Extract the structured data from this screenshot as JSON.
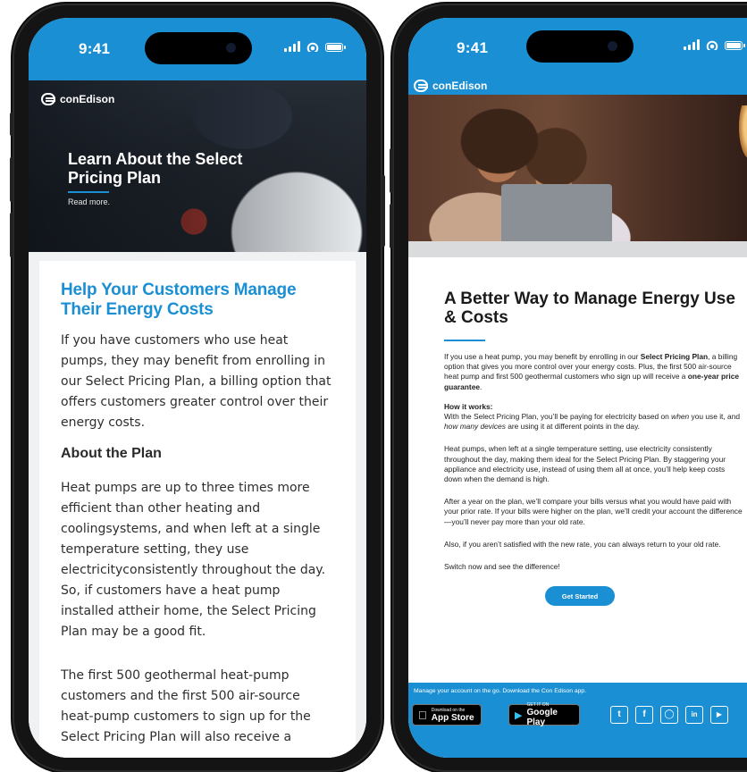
{
  "colors": {
    "brand_blue": "#1b8fd3",
    "dark_bg": "#141414",
    "text": "#2a2a2a"
  },
  "status_bar": {
    "time": "9:41"
  },
  "brand": {
    "name": "conEdison"
  },
  "left": {
    "hero": {
      "title": "Learn About the Select Pricing Plan",
      "link": "Read more."
    },
    "heading": "Help Your Customers Manage Their Energy Costs",
    "intro": "If you have customers who use heat pumps, they may benefit from enrolling in our Select Pricing Plan, a billing option that offers customers greater control over their energy costs.",
    "subheading": "About the Plan",
    "paragraph_1": "Heat pumps are up to three times more efficient than other heating and coolingsystems, and when left at a single temperature setting, they use electricityconsistently throughout the day. So, if customers have a heat pump installed attheir home, the Select Pricing Plan may be a good fit.",
    "paragraph_2": "The first 500 geothermal heat-pump customers and the first 500 air-source heat-pump customers to sign up for the Select Pricing Plan will also receive a"
  },
  "right": {
    "heading": "A Better Way to Manage Energy Use & Costs",
    "intro": {
      "part1": "If you use a heat pump, you may benefit by enrolling in our ",
      "bold1": "Select Pricing Plan",
      "part2": ", a billing option that gives you more control over your energy costs. Plus, the first 500 air-source heat pump and first 500 geothermal customers who sign up will receive a ",
      "bold2": "one-year price guarantee",
      "part3": "."
    },
    "how": {
      "title": "How it works:",
      "part1": "With the Select Pricing Plan, you’ll be paying for electricity based on ",
      "em1": "when",
      "part2": " you use it, and ",
      "em2": "how many devices",
      "part3": " are using it at different points in the day."
    },
    "p2": "Heat pumps, when left at a single temperature setting, use electricity consistently throughout the day, making them ideal for the Select Pricing Plan. By staggering your appliance and electricity use, instead of using them all at once, you’ll help keep costs down when the demand is high.",
    "p3": "After a year on the plan, we’ll compare your bills versus what you would have paid with your prior rate. If your bills were higher on the plan, we’ll credit your account the difference—you’ll never pay more than your old rate.",
    "p4": "Also, if you aren’t satisfied with the new rate, you can always return to your old rate.",
    "p5": "Switch now and see the difference!",
    "cta": "Get Started",
    "footer": {
      "message": "Manage your account on the go. Download the Con Edison app.",
      "app_store_small": "Download on the",
      "app_store": "App Store",
      "google_small": "GET IT ON",
      "google_play": "Google Play",
      "social": [
        "twitter-icon",
        "facebook-icon",
        "instagram-icon",
        "linkedin-icon",
        "youtube-icon"
      ]
    }
  }
}
